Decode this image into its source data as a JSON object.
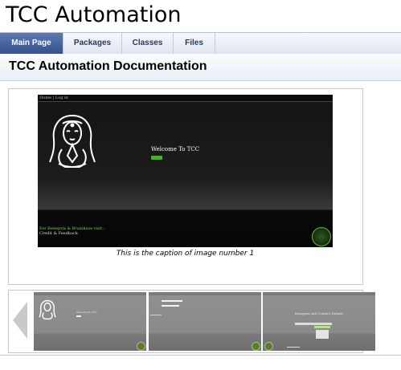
{
  "project": {
    "title": "TCC Automation"
  },
  "tabs": [
    {
      "label": "Main Page",
      "active": true
    },
    {
      "label": "Packages",
      "active": false
    },
    {
      "label": "Classes",
      "active": false
    },
    {
      "label": "Files",
      "active": false
    }
  ],
  "header": {
    "title": "TCC Automation Documentation"
  },
  "slideshow": {
    "current": {
      "topbar_links": "Home | Log in",
      "welcome_text": "Welcome To TCC",
      "button_color": "#4ab02f",
      "footer_line1": "For Beneprix & Brainkase visit :",
      "footer_line2": "Credit & Feedback"
    },
    "caption": "This is the caption of image number 1",
    "prev_icon": "chevron-left-arrow",
    "next_icon": "chevron-right-arrow",
    "thumbnails": [
      {
        "name": "thumbnail-1",
        "text": "Welcome To TCC"
      },
      {
        "name": "thumbnail-2",
        "text": ""
      },
      {
        "name": "thumbnail-3",
        "text": "Beneprix and Contact Details"
      }
    ]
  },
  "colors": {
    "tab_active": "#35508a",
    "tab_text": "#283a5d",
    "accent_green": "#4ab02f"
  }
}
